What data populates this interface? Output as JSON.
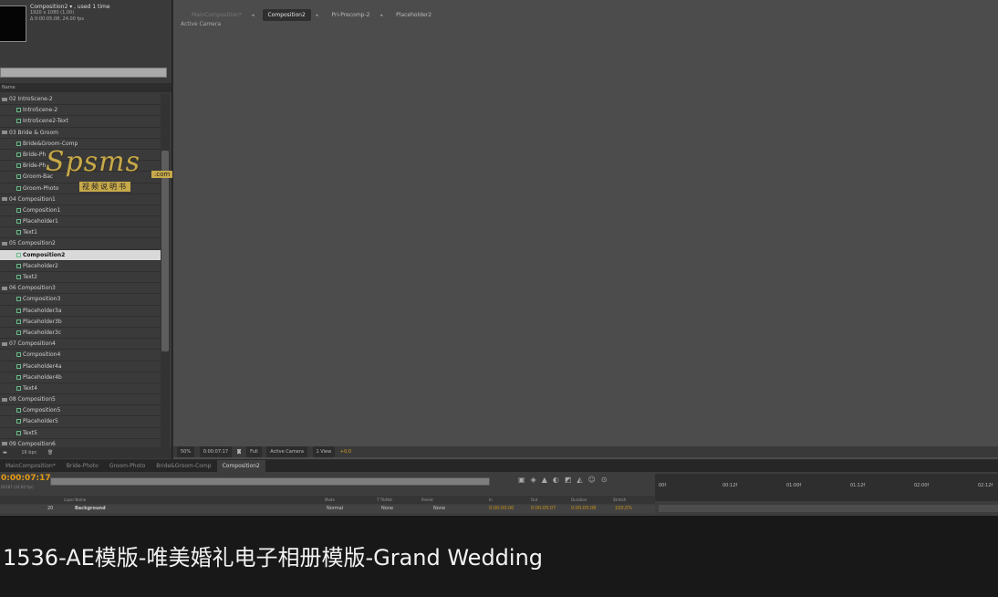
{
  "project": {
    "comp_name": "Composition2 ▾ , used 1 time",
    "comp_size": "1920 x 1080 (1,00)",
    "comp_duration": "Δ 0:00:05:08, 24,00 fps",
    "column_header": "Name",
    "items": [
      {
        "label": "02 IntroScene-2",
        "type": "folder"
      },
      {
        "label": "IntroScene-2",
        "type": "comp"
      },
      {
        "label": "IntroScene2-Text",
        "type": "comp"
      },
      {
        "label": "03 Bride & Groom",
        "type": "folder"
      },
      {
        "label": "Bride&Groom-Comp",
        "type": "comp"
      },
      {
        "label": "Bride-Ph",
        "type": "comp"
      },
      {
        "label": "Bride-Ph",
        "type": "comp"
      },
      {
        "label": "Groom-Bac",
        "type": "comp"
      },
      {
        "label": "Groom-Photo",
        "type": "comp"
      },
      {
        "label": "04 Composition1",
        "type": "folder"
      },
      {
        "label": "Composition1",
        "type": "comp"
      },
      {
        "label": "Placeholder1",
        "type": "comp"
      },
      {
        "label": "Text1",
        "type": "comp"
      },
      {
        "label": "05 Composition2",
        "type": "folder"
      },
      {
        "label": "Composition2",
        "type": "comp",
        "selected": true
      },
      {
        "label": "Placeholder2",
        "type": "comp"
      },
      {
        "label": "Text2",
        "type": "comp"
      },
      {
        "label": "06 Composition3",
        "type": "folder"
      },
      {
        "label": "Composition3",
        "type": "comp"
      },
      {
        "label": "Placeholder3a",
        "type": "comp"
      },
      {
        "label": "Placeholder3b",
        "type": "comp"
      },
      {
        "label": "Placeholder3c",
        "type": "comp"
      },
      {
        "label": "07 Composition4",
        "type": "folder"
      },
      {
        "label": "Composition4",
        "type": "comp"
      },
      {
        "label": "Placeholder4a",
        "type": "comp"
      },
      {
        "label": "Placeholder4b",
        "type": "comp"
      },
      {
        "label": "Text4",
        "type": "comp"
      },
      {
        "label": "08 Composition5",
        "type": "folder"
      },
      {
        "label": "Composition5",
        "type": "comp"
      },
      {
        "label": "Placeholder5",
        "type": "comp"
      },
      {
        "label": "Text5",
        "type": "comp"
      },
      {
        "label": "09 Composition6",
        "type": "folder"
      }
    ],
    "footer_bpc": "16 bpc"
  },
  "viewer": {
    "tabs": [
      "MainComposition*",
      "Composition2",
      "Pri-Precomp-2",
      "Placeholder2"
    ],
    "active_camera_label": "Active Camera",
    "zoom": "50%",
    "timecode": "0:00:07:17",
    "resolution": "Full",
    "camera_select": "Active Camera",
    "views_select": "1 View",
    "exposure": "+0,0"
  },
  "timeline": {
    "tabs": [
      "MainComposition*",
      "Bride-Photo",
      "Groom-Photo",
      "Bride&Groom-Comp",
      "Composition2"
    ],
    "active_tab": "Composition2",
    "timecode": "0:00:07:17",
    "fps_note": "00187 (24.00 fps)",
    "headers": [
      "Layer Name",
      "Mode",
      "T TrkMat",
      "Parent",
      "In",
      "Out",
      "Duration",
      "Stretch"
    ],
    "layer": {
      "index": "20",
      "name": "Background",
      "mode": "Normal",
      "trkmat": "None",
      "parent": "None",
      "in": "0:00:00:00",
      "out": "0:00:05:07",
      "duration": "0:00:05:08",
      "stretch": "100,0%"
    },
    "ruler": [
      "00f",
      "00:12f",
      "01:00f",
      "01:12f",
      "02:00f",
      "02:12f"
    ]
  },
  "caption": "1536-AE模版-唯美婚礼电子相册模版-Grand Wedding",
  "watermark": {
    "brand": "Spsms",
    "domain": ".com",
    "sub": "视频说明书"
  }
}
